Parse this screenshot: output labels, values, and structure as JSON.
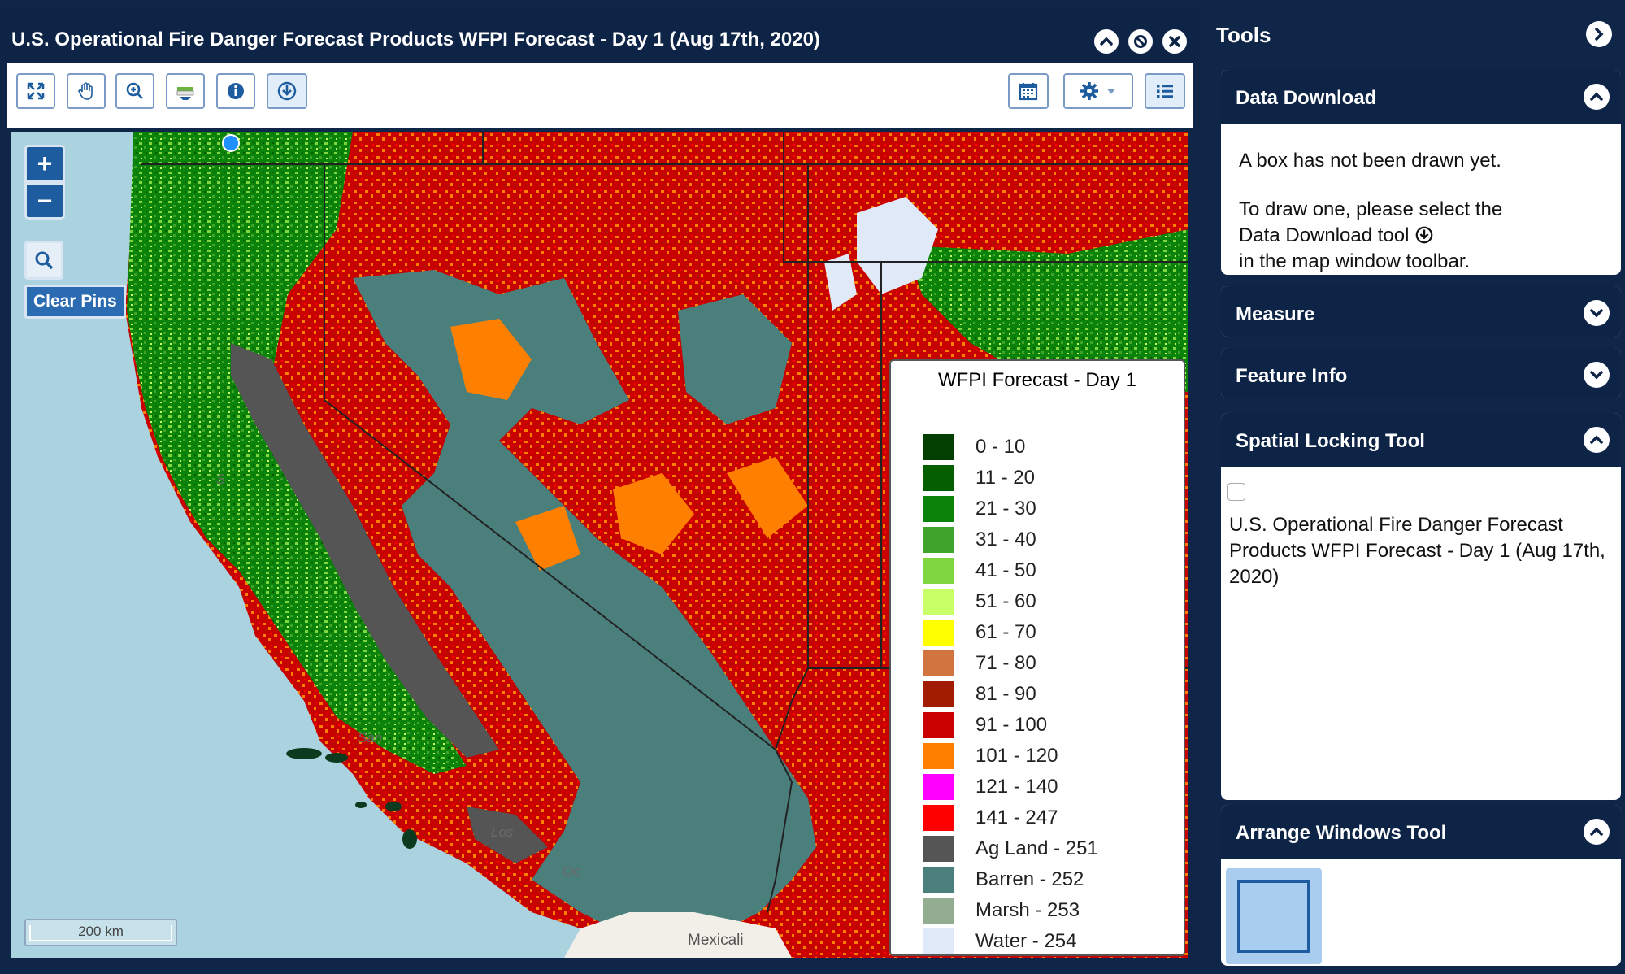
{
  "map_window": {
    "title": "U.S. Operational Fire Danger Forecast Products WFPI Forecast - Day 1 (Aug 17th, 2020)",
    "title_buttons": [
      "collapse",
      "hide",
      "close"
    ],
    "toolbar_left": [
      "full-extent",
      "pan",
      "zoom-in",
      "identify",
      "info",
      "data-download"
    ],
    "toolbar_right": [
      "calendar",
      "settings",
      "legend-list"
    ]
  },
  "map": {
    "clear_pins": "Clear Pins",
    "scale_bar": "200 km",
    "places": {
      "san": "San",
      "los": "Los",
      "oc": "Oc",
      "mexicali": "Mexicali",
      "s": "S"
    },
    "legend": {
      "title": "WFPI Forecast - Day 1",
      "items": [
        {
          "label": "0 - 10",
          "color": "#033f00"
        },
        {
          "label": "11 - 20",
          "color": "#035e00"
        },
        {
          "label": "21 - 30",
          "color": "#0b830b"
        },
        {
          "label": "31 - 40",
          "color": "#3fa52a"
        },
        {
          "label": "41 - 50",
          "color": "#7fd641"
        },
        {
          "label": "51 - 60",
          "color": "#c9ff66"
        },
        {
          "label": "61 - 70",
          "color": "#ffff00"
        },
        {
          "label": "71 - 80",
          "color": "#d2743f"
        },
        {
          "label": "81 - 90",
          "color": "#a11c00"
        },
        {
          "label": "91 - 100",
          "color": "#c90000"
        },
        {
          "label": "101 - 120",
          "color": "#ff8000"
        },
        {
          "label": "121 - 140",
          "color": "#ff00ff"
        },
        {
          "label": "141 - 247",
          "color": "#ff0000"
        },
        {
          "label": "Ag Land - 251",
          "color": "#555555"
        },
        {
          "label": "Barren - 252",
          "color": "#4a7f7c"
        },
        {
          "label": "Marsh - 253",
          "color": "#92ad92"
        },
        {
          "label": "Water - 254",
          "color": "#dfe9f7"
        }
      ]
    }
  },
  "tools": {
    "header": "Tools",
    "data_download": {
      "title": "Data Download",
      "line1": "A box has not been drawn yet.",
      "line2": "To draw one, please select the",
      "line3": "Data Download tool",
      "line4": "in the map window toolbar."
    },
    "measure": {
      "title": "Measure"
    },
    "feature_info": {
      "title": "Feature Info"
    },
    "spatial_locking": {
      "title": "Spatial Locking Tool",
      "layer_line1": "U.S. Operational Fire Danger Forecast",
      "layer_line2": "Products WFPI Forecast - Day 1 (Aug 17th,",
      "layer_line3": "2020)",
      "checked": false
    },
    "arrange_windows": {
      "title": "Arrange Windows Tool"
    }
  },
  "colors": {
    "navy": "#0e2447",
    "toolbar_border": "#7a9bc6",
    "ocean": "#aad3df"
  }
}
